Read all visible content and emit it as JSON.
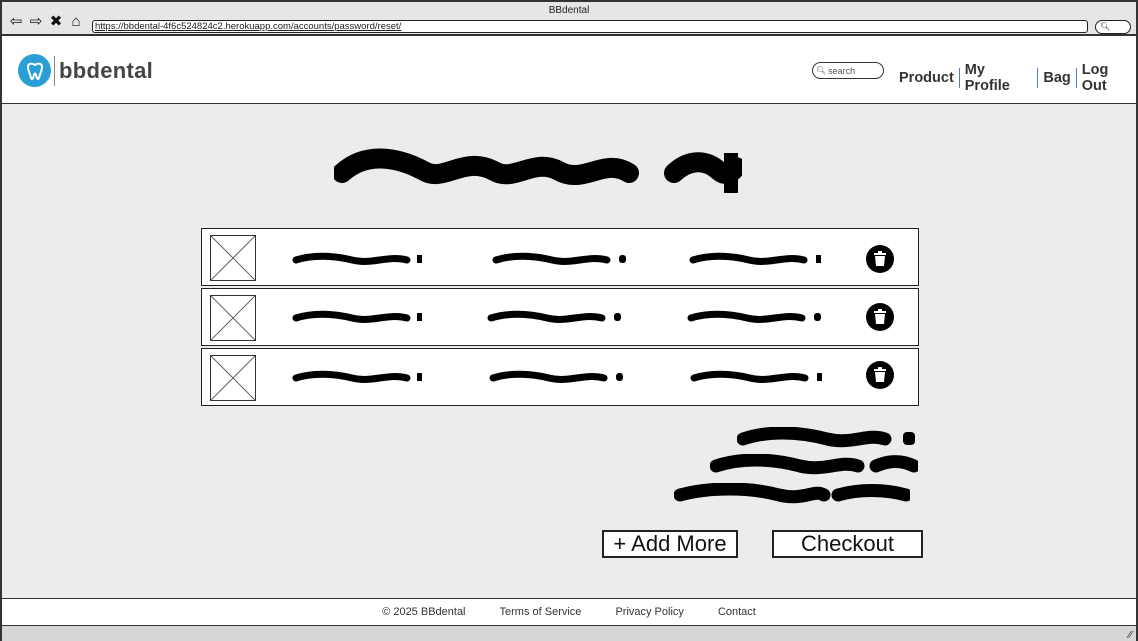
{
  "window": {
    "title": "BBdental",
    "url": "https://bbdental-4f6c524824c2.herokuapp.com/accounts/password/reset/"
  },
  "header": {
    "logo_text": "bbdental",
    "search_placeholder": "search",
    "nav": [
      "Product",
      "My Profile",
      "Bag",
      "Log Out"
    ]
  },
  "cart": {
    "item_count": 3,
    "add_more_label": "+ Add More",
    "checkout_label": "Checkout"
  },
  "footer": {
    "copyright": "© 2025 BBdental",
    "links": [
      "Terms of Service",
      "Privacy Policy",
      "Contact"
    ]
  },
  "icons": [
    "back-icon",
    "forward-icon",
    "close-icon",
    "home-icon",
    "tooth-logo-icon",
    "search-icon",
    "trash-icon",
    "image-placeholder-icon",
    "resize-handle-icon"
  ],
  "colors": {
    "brand": "#2a9fd6",
    "nav_separator": "#4a7fc1",
    "page_bg": "#ececec"
  }
}
